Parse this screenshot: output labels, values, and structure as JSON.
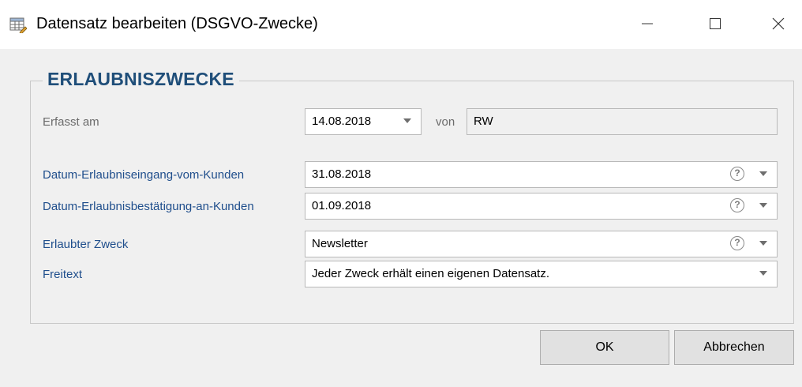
{
  "window": {
    "title": "Datensatz bearbeiten (DSGVO-Zwecke)",
    "minimize_glyph": "—",
    "close_glyph": "✕"
  },
  "group": {
    "title": "ERLAUBNISZWECKE"
  },
  "fields": {
    "erfasst_label": "Erfasst am",
    "erfasst_value": "14.08.2018",
    "von_label": "von",
    "von_value": "RW",
    "eingang_label": "Datum-Erlaubniseingang-vom-Kunden",
    "eingang_value": "31.08.2018",
    "bestaetigung_label": "Datum-Erlaubnisbestätigung-an-Kunden",
    "bestaetigung_value": "01.09.2018",
    "zweck_label": "Erlaubter Zweck",
    "zweck_value": "Newsletter",
    "freitext_label": "Freitext",
    "freitext_value": "Jeder Zweck erhält einen eigenen Datensatz."
  },
  "icons": {
    "help": "?"
  },
  "buttons": {
    "ok": "OK",
    "cancel": "Abbrechen"
  },
  "colors": {
    "label_blue": "#1f4e8c",
    "title_blue": "#1f4e79"
  }
}
